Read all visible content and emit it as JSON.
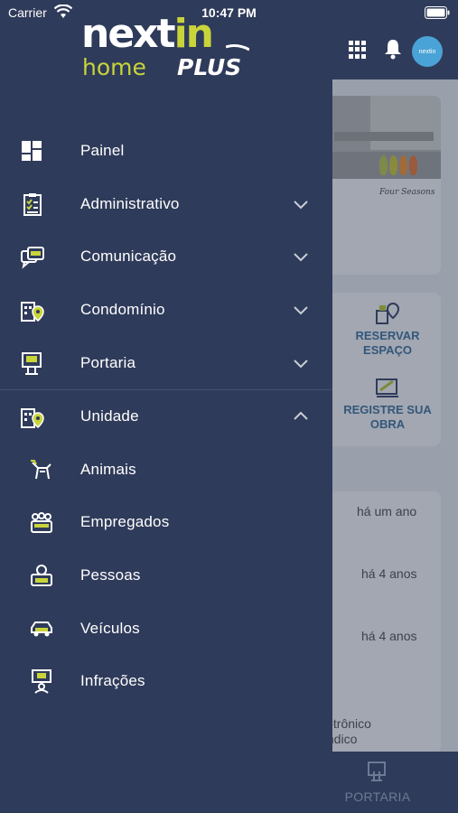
{
  "status_bar": {
    "carrier": "Carrier",
    "time": "10:47 PM"
  },
  "brand": {
    "logo_next": "next",
    "logo_in": "in",
    "logo_home": "home",
    "logo_plus": "PLUS"
  },
  "menu": {
    "items": [
      {
        "label": "Painel",
        "icon": "dashboard-icon"
      },
      {
        "label": "Administrativo",
        "icon": "clipboard-checklist-icon",
        "chevron": "down"
      },
      {
        "label": "Comunicação",
        "icon": "chat-bubbles-icon",
        "chevron": "down"
      },
      {
        "label": "Condomínio",
        "icon": "building-pin-icon",
        "chevron": "down"
      },
      {
        "label": "Portaria",
        "icon": "gate-access-icon",
        "chevron": "down"
      },
      {
        "label": "Unidade",
        "icon": "building-pin-icon",
        "chevron": "up"
      }
    ],
    "sub_items": [
      {
        "label": "Animais",
        "icon": "dog-icon"
      },
      {
        "label": "Empregados",
        "icon": "people-group-icon"
      },
      {
        "label": "Pessoas",
        "icon": "person-id-icon"
      },
      {
        "label": "Veículos",
        "icon": "car-icon"
      },
      {
        "label": "Infrações",
        "icon": "warning-board-icon"
      }
    ]
  },
  "background": {
    "card1_caption": "Four Seasons",
    "action_reservar": "RESERVAR ESPAÇO",
    "action_registre": "REGISTRE SUA OBRA",
    "time_1": "há um ano",
    "time_2": "há 4 anos",
    "time_3": "há 4 anos",
    "fragment_line1": "letrônico",
    "fragment_line2": "índico",
    "avatar_text": "nextin",
    "tab_portaria": "PORTARIA"
  },
  "colors": {
    "drawer_bg": "#2f3b5a",
    "accent_lime": "#c8d43a",
    "text_white": "#ffffff",
    "overlay": "#9aa0ab"
  }
}
